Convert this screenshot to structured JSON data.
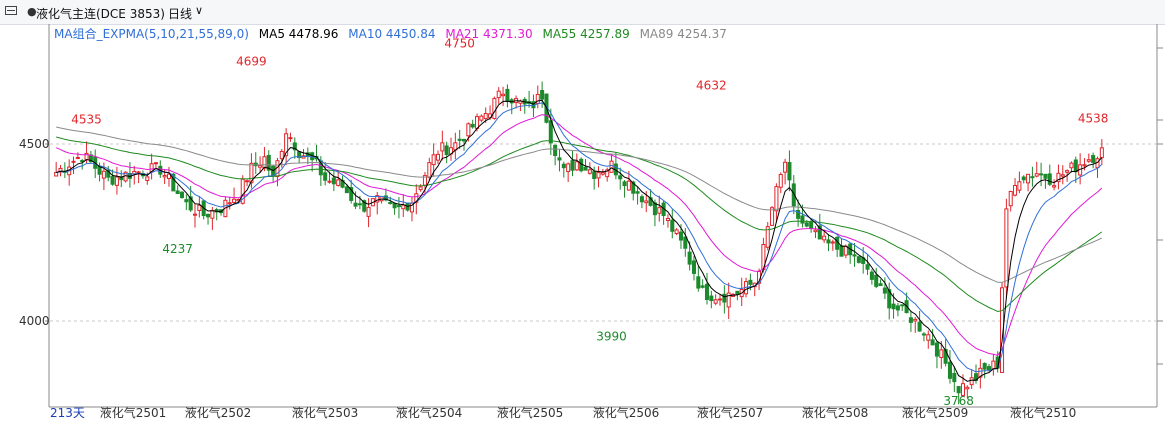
{
  "header": {
    "title": "液化气主连(DCE 3853)",
    "period": "日线"
  },
  "indicator": {
    "name": "MA组合_EXPMA(5,10,21,55,89,0)",
    "items": [
      {
        "label": "MA5 4478.96",
        "color": "#000000"
      },
      {
        "label": "MA10 4450.84",
        "color": "#2f6fd6"
      },
      {
        "label": "MA21 4371.30",
        "color": "#e11ad6"
      },
      {
        "label": "MA55 4257.89",
        "color": "#1f8a1f"
      },
      {
        "label": "MA89 4254.37",
        "color": "#8a8a8a"
      }
    ],
    "name_color": "#2f6fd6"
  },
  "bars_label": "213天",
  "chart_data": {
    "type": "candlestick",
    "yticks": [
      4000,
      4500
    ],
    "ylim": [
      3760,
      4830
    ],
    "x_labels": [
      "液化气2501",
      "液化气2502",
      "液化气2503",
      "液化气2504",
      "液化气2505",
      "液化气2506",
      "液化气2507",
      "液化气2508",
      "液化气2509",
      "液化气2510"
    ],
    "annotations": [
      {
        "text": "4535",
        "value": 4535,
        "type": "high"
      },
      {
        "text": "4237",
        "value": 4237,
        "type": "low"
      },
      {
        "text": "4699",
        "value": 4699,
        "type": "high"
      },
      {
        "text": "4750",
        "value": 4750,
        "type": "high"
      },
      {
        "text": "3990",
        "value": 3990,
        "type": "low"
      },
      {
        "text": "4632",
        "value": 4632,
        "type": "high"
      },
      {
        "text": "3768",
        "value": 3768,
        "type": "low"
      },
      {
        "text": "4538",
        "value": 4538,
        "type": "high"
      }
    ],
    "close_anchors": [
      [
        0,
        4420
      ],
      [
        6,
        4470
      ],
      [
        12,
        4400
      ],
      [
        18,
        4420
      ],
      [
        24,
        4430
      ],
      [
        30,
        4330
      ],
      [
        34,
        4300
      ],
      [
        38,
        4320
      ],
      [
        42,
        4360
      ],
      [
        45,
        4430
      ],
      [
        48,
        4460
      ],
      [
        50,
        4400
      ],
      [
        53,
        4540
      ],
      [
        56,
        4480
      ],
      [
        60,
        4440
      ],
      [
        62,
        4400
      ],
      [
        66,
        4380
      ],
      [
        70,
        4320
      ],
      [
        74,
        4340
      ],
      [
        78,
        4310
      ],
      [
        82,
        4340
      ],
      [
        86,
        4440
      ],
      [
        88,
        4480
      ],
      [
        92,
        4500
      ],
      [
        96,
        4550
      ],
      [
        100,
        4600
      ],
      [
        103,
        4650
      ],
      [
        106,
        4620
      ],
      [
        109,
        4600
      ],
      [
        112,
        4640
      ],
      [
        114,
        4520
      ],
      [
        117,
        4420
      ],
      [
        120,
        4450
      ],
      [
        124,
        4420
      ],
      [
        128,
        4440
      ],
      [
        132,
        4390
      ],
      [
        136,
        4340
      ],
      [
        140,
        4300
      ],
      [
        145,
        4200
      ],
      [
        149,
        4080
      ],
      [
        153,
        4070
      ],
      [
        157,
        4080
      ],
      [
        161,
        4110
      ],
      [
        163,
        4200
      ],
      [
        165,
        4320
      ],
      [
        168,
        4450
      ],
      [
        170,
        4310
      ],
      [
        173,
        4260
      ],
      [
        177,
        4220
      ],
      [
        181,
        4200
      ],
      [
        185,
        4170
      ],
      [
        189,
        4100
      ],
      [
        193,
        4040
      ],
      [
        197,
        4010
      ],
      [
        201,
        3960
      ],
      [
        205,
        3880
      ],
      [
        208,
        3810
      ],
      [
        211,
        3830
      ],
      [
        214,
        3860
      ],
      [
        217,
        3880
      ],
      [
        219,
        4320
      ],
      [
        222,
        4410
      ],
      [
        226,
        4420
      ],
      [
        230,
        4400
      ],
      [
        234,
        4430
      ],
      [
        238,
        4460
      ],
      [
        241,
        4480
      ]
    ],
    "ma_lines": [
      {
        "name": "MA21",
        "color": "#e11ad6",
        "period": 21
      },
      {
        "name": "MA55",
        "color": "#1f8a1f",
        "period": 55
      },
      {
        "name": "MA89",
        "color": "#8a8a8a",
        "period": 89
      },
      {
        "name": "MA10",
        "color": "#2f6fd6",
        "period": 10
      },
      {
        "name": "MA5",
        "color": "#000000",
        "period": 5
      }
    ],
    "colors": {
      "up": "#e0262b",
      "down": "#1c8a2c",
      "axis": "#888888",
      "grid": "#c8c8c8",
      "text": "#333333"
    }
  }
}
